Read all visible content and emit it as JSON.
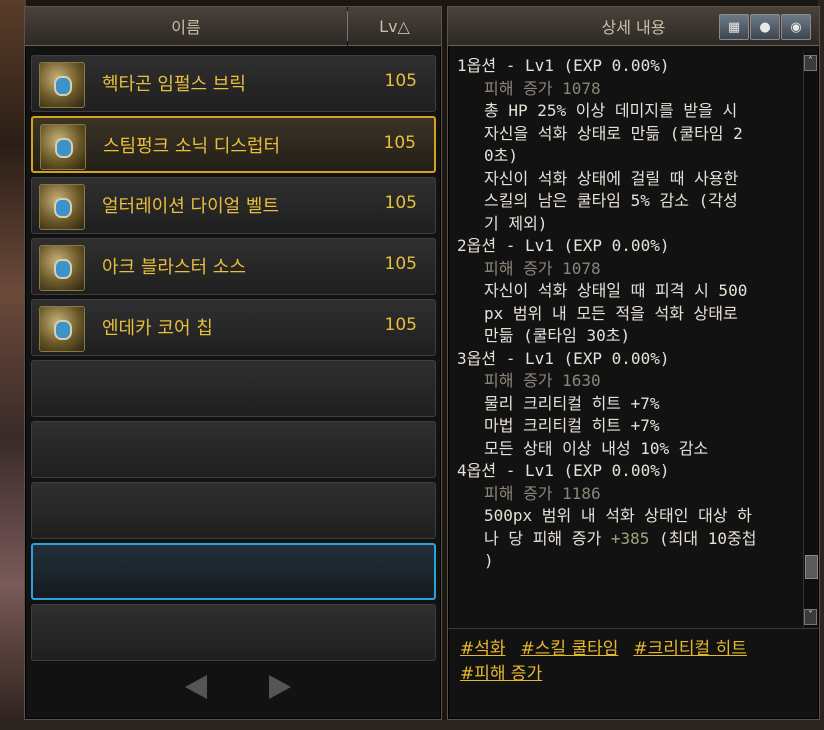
{
  "left_panel": {
    "header": {
      "name_label": "이름",
      "level_label": "Lv△"
    },
    "items": [
      {
        "name": "헥타곤 임펄스 브릭",
        "level": "105"
      },
      {
        "name": "스팀펑크 소닉 디스럽터",
        "level": "105"
      },
      {
        "name": "얼터레이션 다이얼 벨트",
        "level": "105"
      },
      {
        "name": "아크 블라스터 소스",
        "level": "105"
      },
      {
        "name": "엔데카 코어 칩",
        "level": "105"
      }
    ]
  },
  "right_panel": {
    "header": {
      "title": "상세 내용",
      "buttons": [
        "armor-icon",
        "map-pin-icon",
        "eye-icon"
      ]
    },
    "options": [
      {
        "title": "1옵션 - Lv1 (EXP 0.00%)",
        "damage": "피해 증가 1078",
        "lines": [
          "총 HP 25% 이상 데미지를 받을 시",
          "자신을 석화 상태로 만듦 (쿨타임 2",
          "0초)",
          "자신이 석화 상태에 걸릴 때 사용한",
          "스킬의 남은 쿨타임 5% 감소 (각성",
          "기 제외)"
        ]
      },
      {
        "title": "2옵션 - Lv1 (EXP 0.00%)",
        "damage": "피해 증가 1078",
        "lines": [
          "자신이 석화 상태일 때 피격 시 500",
          "px 범위 내 모든 적을 석화 상태로",
          "만듦 (쿨타임 30초)"
        ]
      },
      {
        "title": "3옵션 - Lv1 (EXP 0.00%)",
        "damage": "피해 증가 1630",
        "lines": [
          "물리 크리티컬 히트 +7%",
          "마법 크리티컬 히트 +7%",
          "모든 상태 이상 내성 10% 감소"
        ]
      },
      {
        "title": "4옵션 - Lv1 (EXP 0.00%)",
        "damage": "피해 증가 1186",
        "lines": [
          "500px 범위 내 석화 상태인 대상 하"
        ],
        "last_pre": "나 당 피해 증가 ",
        "last_value": "+385",
        "last_post": " (최대 10중첩",
        "tail": ")"
      }
    ],
    "tags": [
      "#석화",
      "#스킬 쿨타임",
      "#크리티컬 히트",
      "#피해 증가"
    ]
  },
  "colors": {
    "item_text": "#e9bf3c",
    "selected_border": "#d4a21c",
    "hover_border": "#2aa3d9",
    "tag_text": "#e6b82e"
  }
}
